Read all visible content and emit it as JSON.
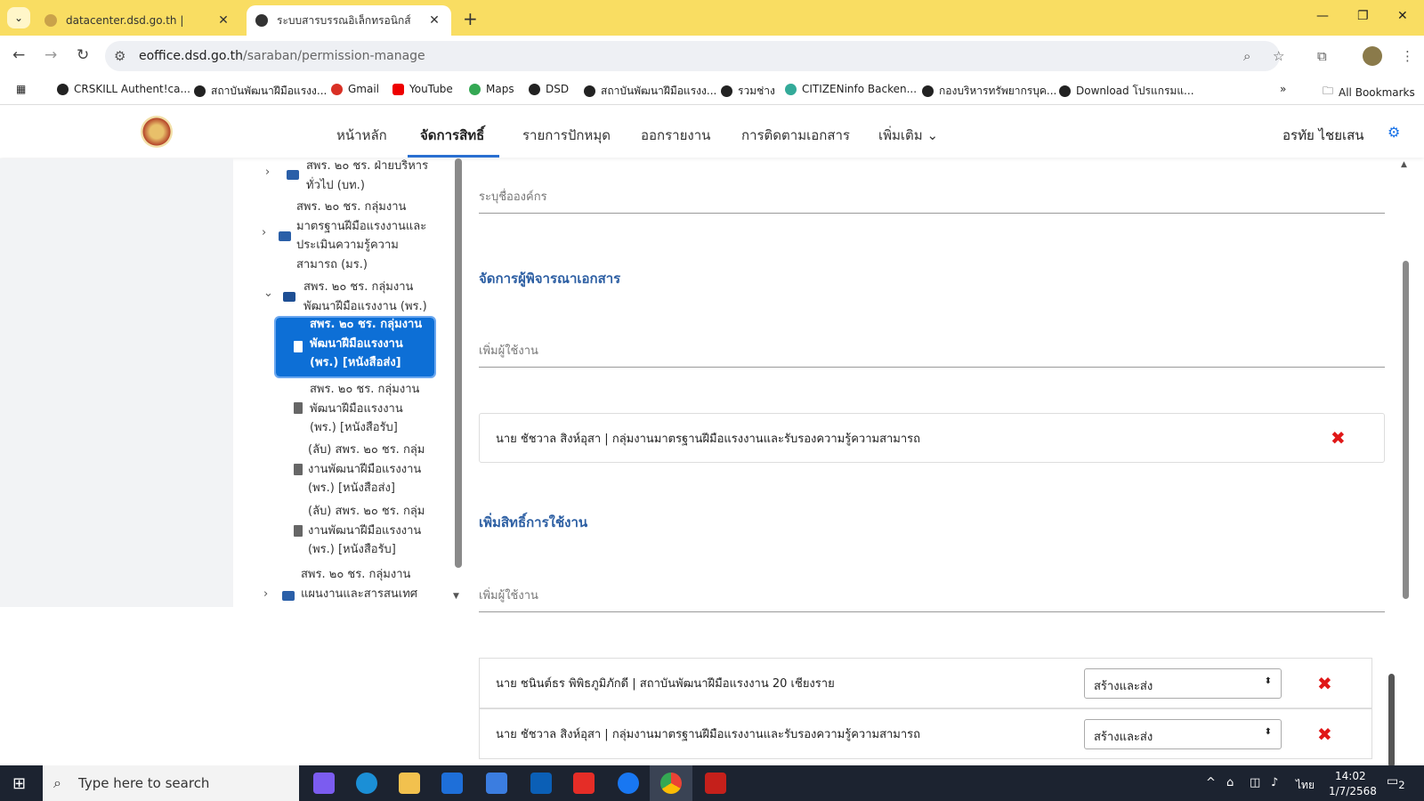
{
  "browser": {
    "tabs": [
      {
        "title": "datacenter.dsd.go.th |"
      },
      {
        "title": "ระบบสารบรรณอิเล็กทรอนิกส์"
      }
    ],
    "url_host": "eoffice.dsd.go.th",
    "url_path": "/saraban/permission-manage",
    "bookmarks": [
      "CRSKILL Authent!ca...",
      "สถาบันพัฒนาฝีมือแรงง...",
      "Gmail",
      "YouTube",
      "Maps",
      "DSD",
      "สถาบันพัฒนาฝีมือแรงง...",
      "รวมช่าง",
      "CITIZENinfo Backen...",
      "กองบริหารทรัพยากรบุค...",
      "Download โปรแกรมแ..."
    ],
    "all_bookmarks": "All Bookmarks"
  },
  "header": {
    "nav": [
      "หน้าหลัก",
      "จัดการสิทธิ์",
      "รายการปักหมุด",
      "ออกรายงาน",
      "การติดตามเอกสาร",
      "เพิ่มเติม"
    ],
    "user": "อรทัย ไชยเสน"
  },
  "tree": {
    "items": [
      {
        "lines": [
          "สพร. ๒๐ ชร. ฝ่ายบริหาร",
          "ทั่วไป (บท.)"
        ]
      },
      {
        "lines": [
          "สพร. ๒๐ ชร. กลุ่มงาน",
          "มาตรฐานฝีมือแรงงานและ",
          "ประเมินความรู้ความ",
          "สามารถ (มร.)"
        ]
      },
      {
        "lines": [
          "สพร. ๒๐ ชร. กลุ่มงาน",
          "พัฒนาฝีมือแรงงาน (พร.)"
        ]
      },
      {
        "lines": [
          "สพร. ๒๐ ชร. กลุ่มงาน",
          "พัฒนาฝีมือแรงงาน",
          "(พร.) [หนังสือส่ง]"
        ]
      },
      {
        "lines": [
          "สพร. ๒๐ ชร. กลุ่มงาน",
          "พัฒนาฝีมือแรงงาน",
          "(พร.) [หนังสือรับ]"
        ]
      },
      {
        "lines": [
          "(ลับ) สพร. ๒๐ ชร. กลุ่ม",
          "งานพัฒนาฝีมือแรงงาน",
          "(พร.) [หนังสือส่ง]"
        ]
      },
      {
        "lines": [
          "(ลับ) สพร. ๒๐ ชร. กลุ่ม",
          "งานพัฒนาฝีมือแรงงาน",
          "(พร.) [หนังสือรับ]"
        ]
      },
      {
        "lines": [
          "สพร. ๒๐ ชร. กลุ่มงาน",
          "แผนงานและสารสนเทศ"
        ]
      }
    ]
  },
  "main": {
    "org_placeholder": "ระบุชื่อองค์กร",
    "reviewer_section": "จัดการผู้พิจารณาเอกสาร",
    "add_user_placeholder_1": "เพิ่มผู้ใช้งาน",
    "reviewer": "นาย ชัชวาล สิงห์อุสา | กลุ่มงานมาตรฐานฝีมือแรงงานและรับรองความรู้ความสามารถ",
    "permission_section": "เพิ่มสิทธิ์การใช้งาน",
    "add_user_placeholder_2": "เพิ่มผู้ใช้งาน",
    "permissions": [
      {
        "user": "นาย ชนินต์ธร พิพิธภูมิภักดี | สถาบันพัฒนาฝีมือแรงงาน 20 เชียงราย",
        "role": "สร้างและส่ง"
      },
      {
        "user": "นาย ชัชวาล สิงห์อุสา | กลุ่มงานมาตรฐานฝีมือแรงงานและรับรองความรู้ความสามารถ",
        "role": "สร้างและส่ง"
      }
    ]
  },
  "taskbar": {
    "search_placeholder": "Type here to search",
    "lang": "ไทย",
    "time": "14:02",
    "date": "1/7/2568",
    "notif_count": "2"
  }
}
